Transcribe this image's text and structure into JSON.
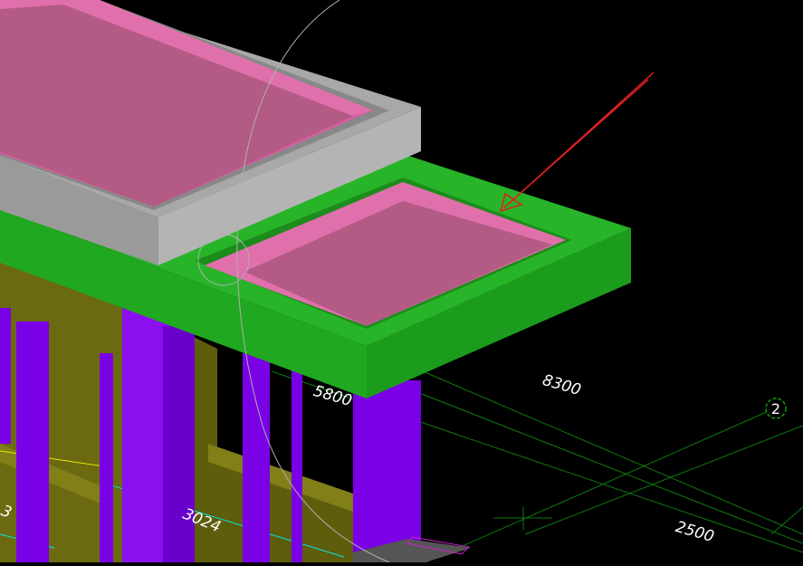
{
  "viewport": {
    "background": "#000000",
    "colors": {
      "slab_pink": "#d45fa0",
      "slab_pink_light": "#e070ab",
      "wall_gray": "#a8a8a8",
      "beam_green": "#21a821",
      "column_purple": "#7a00e6",
      "foundation_olive": "#6b6a10",
      "grid_green": "#0f7a0f",
      "annotation_red": "#e02020"
    }
  },
  "dimensions": {
    "d8300": "8300",
    "d5800": "5800",
    "d2500": "2500",
    "d3024": "3024",
    "d3": "3"
  },
  "grid_axis": {
    "label": "2",
    "icon": "axis-bubble-icon"
  },
  "annotation": {
    "icon": "red-arrow-icon"
  }
}
